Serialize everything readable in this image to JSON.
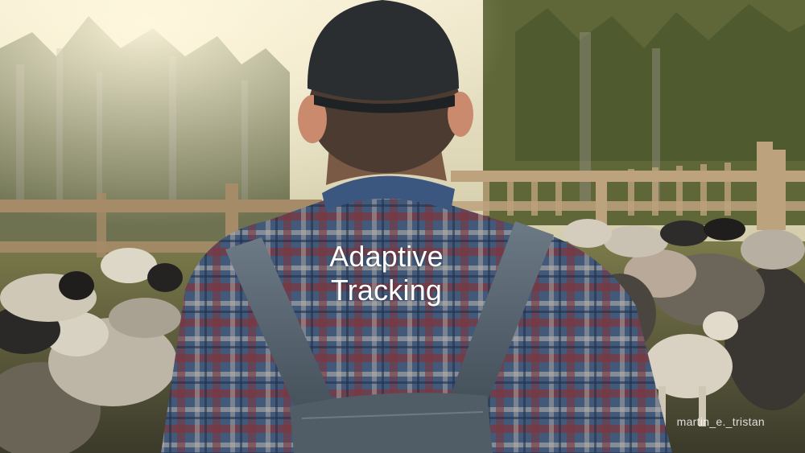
{
  "caption": {
    "line1": "Adaptive",
    "line2": "Tracking"
  },
  "watermark": "martin_e._tristan",
  "colors": {
    "sky": "#e9e3c6",
    "forest": "#6f7047",
    "fence": "#a68c6a",
    "shirt_blue": "#3f5a7e",
    "shirt_red": "#8a3a3a",
    "overalls": "#56626c",
    "cap": "#2a2d30",
    "sheep_wool": "#cfc8b8",
    "sheep_dark": "#2b2a28"
  }
}
